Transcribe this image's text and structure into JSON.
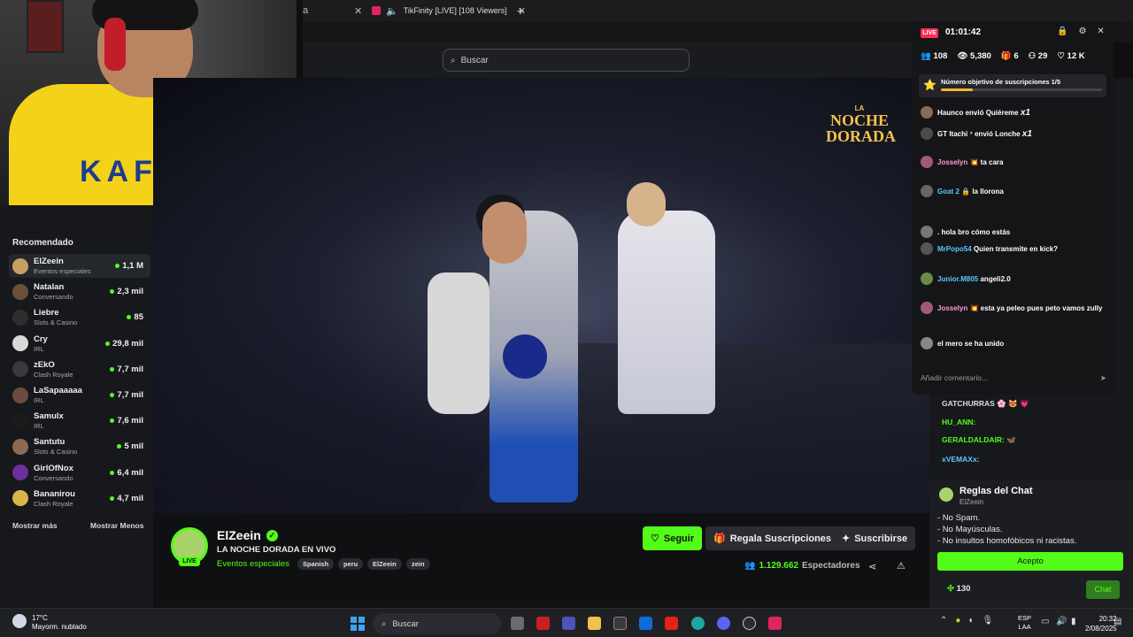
{
  "browser": {
    "tab_title": "TikFinity [LIVE] [108 Viewers]",
    "new_tab": "+"
  },
  "kick": {
    "search_placeholder": "Buscar"
  },
  "sidebar": {
    "section_title": "Recomendado",
    "items": [
      {
        "name": "ElZeein",
        "category": "Eventos especiales",
        "viewers": "1,1 M",
        "color": "#c9a062"
      },
      {
        "name": "Natalan",
        "category": "Conversando",
        "viewers": "2,3 mil",
        "color": "#6b4f3a"
      },
      {
        "name": "Liebre",
        "category": "Slots & Casino",
        "viewers": "85",
        "color": "#2e2e2e"
      },
      {
        "name": "Cry",
        "category": "IRL",
        "viewers": "29,8 mil",
        "color": "#d9d9d9"
      },
      {
        "name": "zEkO",
        "category": "Clash Royale",
        "viewers": "7,7 mil",
        "color": "#3a3a3a"
      },
      {
        "name": "LaSapaaaaa",
        "category": "IRL",
        "viewers": "7,7 mil",
        "color": "#6a4d3e"
      },
      {
        "name": "Samulx",
        "category": "IRL",
        "viewers": "7,6 mil",
        "color": "#1b1b1b"
      },
      {
        "name": "Santutu",
        "category": "Slots & Casino",
        "viewers": "5 mil",
        "color": "#8c6a52"
      },
      {
        "name": "GirlOfNox",
        "category": "Conversando",
        "viewers": "6,4 mil",
        "color": "#6d2f9a"
      },
      {
        "name": "Bananirou",
        "category": "Clash Royale",
        "viewers": "4,7 mil",
        "color": "#d9b64a"
      }
    ],
    "show_more": "Mostrar más",
    "show_less": "Mostrar Menos"
  },
  "video": {
    "logo_small": "LA",
    "logo_line1": "NOCHE",
    "logo_line2": "DORADA"
  },
  "stream": {
    "live_tag": "LIVE",
    "streamer": "ElZeein",
    "title": "LA NOCHE DORADA EN VIVO",
    "category": "Eventos especiales",
    "tags": [
      "Spanish",
      "peru",
      "ElZeein",
      "zein"
    ],
    "follow": "Seguir",
    "gift": "Regala Suscripciones",
    "subscribe": "Suscribirse",
    "viewer_count": "1.129.662",
    "viewer_label": "Espectadores"
  },
  "chat": {
    "lines": [
      {
        "user": "GATCHURRAS",
        "text": "🌸 😻 💗",
        "color": "#dedede"
      },
      {
        "user": "HU_ANN:",
        "text": "",
        "color": "#53fc18"
      },
      {
        "user": "GERALDALDAIR:",
        "text": "🦋",
        "color": "#53fc18"
      },
      {
        "user": "xVEMAXx:",
        "text": "",
        "color": "#5ac8fa"
      }
    ],
    "rules_title": "Reglas del Chat",
    "rules_sub": "ElZeein",
    "rules": [
      "- No Spam.",
      "- No Mayúsculas.",
      "- No insultos homofóbicos ni racistas."
    ],
    "accept": "Acepto",
    "points": "130",
    "chat_button": "Chat"
  },
  "overlay": {
    "live": "LIVE",
    "timer": "01:01:42",
    "stats": [
      "108",
      "5,380",
      "6",
      "29",
      "12 K"
    ],
    "goal_text": "Número objetivo de suscripciones 1/5",
    "goal_fraction": 0.2,
    "events": [
      {
        "user": "Haunco",
        "text": "envió Quiéreme",
        "mult": "x1",
        "color": "#8a6a52"
      },
      {
        "user": "GT Itachi ⁷",
        "text": "envió Lonche",
        "mult": "x1",
        "color": "#4a4a4a"
      },
      {
        "user": "Josselyn 💥",
        "text": "ta cara",
        "mult": "",
        "color": "#a05a7a"
      },
      {
        "user": "Goat 2 🔒",
        "text": "la llorona",
        "mult": "",
        "color": "#666"
      },
      {
        "user": "",
        "text": ". hola bro cómo estás",
        "mult": "",
        "color": "#777"
      },
      {
        "user": "MrPopo54",
        "text": "Quien transmite en kick?",
        "mult": "",
        "color": "#555"
      },
      {
        "user": "Junior.M805",
        "text": "angeli2.0",
        "mult": "",
        "color": "#6a8a4a"
      },
      {
        "user": "Josselyn 💥",
        "text": "esta ya peleo pues peto vamos zully",
        "mult": "",
        "color": "#a05a7a"
      },
      {
        "user": "",
        "text": "el mero se ha unido",
        "mult": "",
        "color": "#888"
      }
    ],
    "comment_placeholder": "Añadir comentario..."
  },
  "taskbar": {
    "temp": "17°C",
    "weather": "Mayorm. nublado",
    "search": "Buscar",
    "lang1": "ESP",
    "lang2": "LAA",
    "time": "20:32",
    "date": "2/08/2025"
  }
}
